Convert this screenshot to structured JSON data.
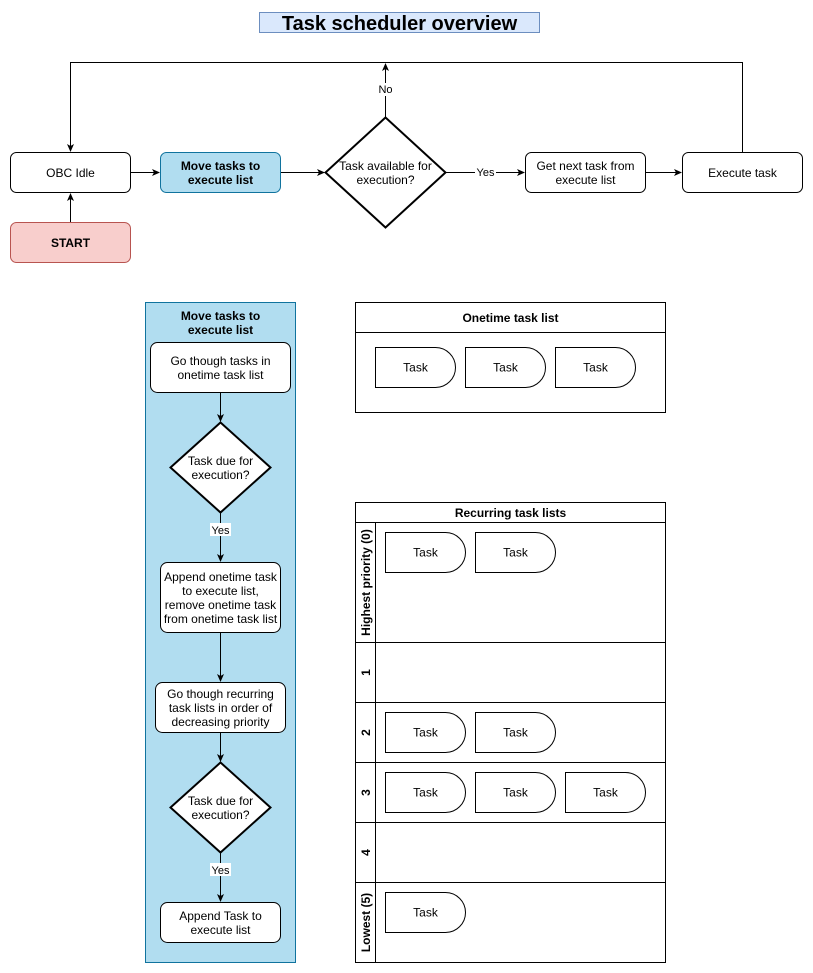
{
  "title": "Task scheduler overview",
  "colors": {
    "title_fill": "#dae8fc",
    "title_stroke": "#6c8ebf",
    "start_fill": "#f8cecc",
    "start_stroke": "#b85450",
    "process_fill": "#b1ddf0",
    "process_stroke": "#10739e"
  },
  "main_flow": {
    "obc_idle": "OBC Idle",
    "start": "START",
    "move_tasks": [
      "Move tasks to",
      "execute list"
    ],
    "decision": [
      "Task available for",
      "execution?"
    ],
    "no_label": "No",
    "yes_label": "Yes",
    "get_next": [
      "Get next task from",
      "execute list"
    ],
    "execute": "Execute task"
  },
  "subprocess": {
    "title": [
      "Move tasks to",
      "execute list"
    ],
    "step1": [
      "Go though tasks in",
      "onetime task list"
    ],
    "decision1": [
      "Task due for",
      "execution?"
    ],
    "yes1": "Yes",
    "step2": [
      "Append onetime task",
      "to execute list,",
      "remove onetime task",
      "from onetime task list"
    ],
    "step3": [
      "Go though recurring",
      "task lists in order of",
      "decreasing priority"
    ],
    "decision2": [
      "Task due for",
      "execution?"
    ],
    "yes2": "Yes",
    "step4": [
      "Append Task to",
      "execute list"
    ]
  },
  "onetime_list": {
    "title": "Onetime task list",
    "tasks": [
      "Task",
      "Task",
      "Task"
    ]
  },
  "recurring_lists": {
    "title": "Recurring task lists",
    "lanes": [
      {
        "label": "Highest priority (0)",
        "tasks": [
          "Task",
          "Task"
        ]
      },
      {
        "label": "1",
        "tasks": []
      },
      {
        "label": "2",
        "tasks": [
          "Task",
          "Task"
        ]
      },
      {
        "label": "3",
        "tasks": [
          "Task",
          "Task",
          "Task"
        ]
      },
      {
        "label": "4",
        "tasks": []
      },
      {
        "label": "Lowest (5)",
        "tasks": [
          "Task"
        ]
      }
    ]
  }
}
